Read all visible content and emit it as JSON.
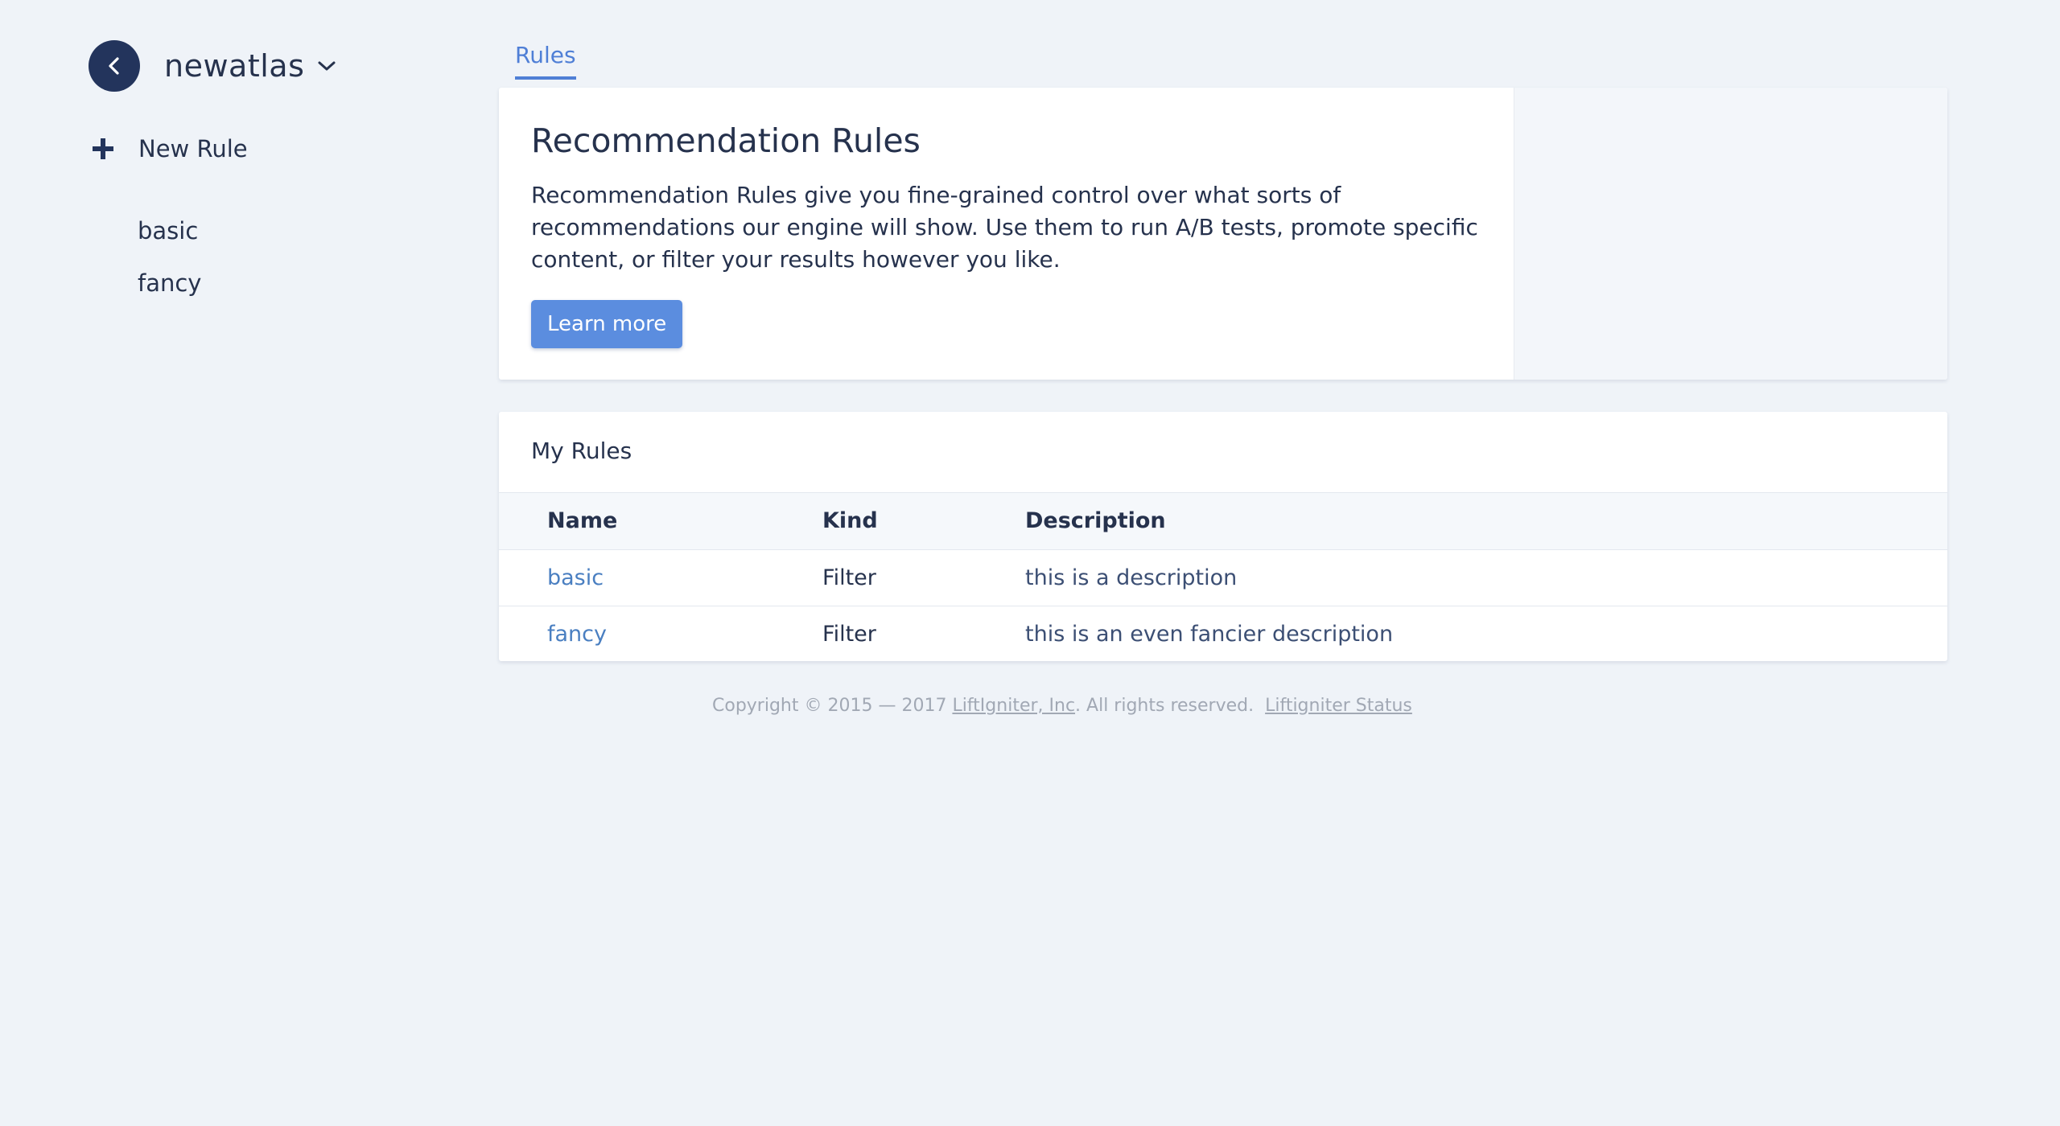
{
  "sidebar": {
    "account_name": "newatlas",
    "new_rule_label": "New Rule",
    "rules": [
      "basic",
      "fancy"
    ]
  },
  "tabs": [
    {
      "label": "Rules",
      "active": true
    }
  ],
  "intro": {
    "title": "Recommendation Rules",
    "text": "Recommendation Rules give you fine-grained control over what sorts of recommendations our engine will show. Use them to run A/B tests, promote specific content, or filter your results however you like.",
    "button_label": "Learn more"
  },
  "my_rules": {
    "title": "My Rules",
    "columns": [
      "Name",
      "Kind",
      "Description"
    ],
    "rows": [
      {
        "name": "basic",
        "kind": "Filter",
        "description": "this is a description"
      },
      {
        "name": "fancy",
        "kind": "Filter",
        "description": "this is an even fancier description"
      }
    ]
  },
  "footer": {
    "copyright_prefix": "Copyright © 2015 — 2017 ",
    "company_link": "LiftIgniter, Inc",
    "rights": ". All rights reserved.  ",
    "status_link": "Liftigniter Status"
  },
  "colors": {
    "accent": "#5b8ddf",
    "link": "#4a7fc1",
    "navy": "#23345c",
    "background": "#eff3f8"
  },
  "icons": [
    "chevron-left-icon",
    "chevron-down-icon",
    "plus-icon"
  ]
}
